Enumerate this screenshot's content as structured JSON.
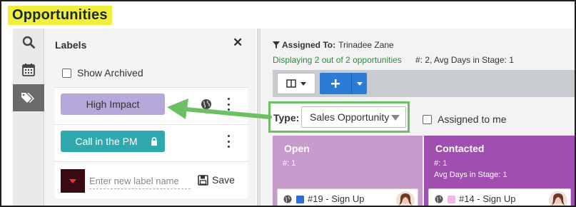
{
  "page_title": "Opportunities",
  "labels_panel": {
    "title": "Labels",
    "show_archived": "Show Archived",
    "labels": [
      {
        "name": "High Impact",
        "color": "#b6a8d9"
      },
      {
        "name": "Call in the PM",
        "color": "#2fa9ae"
      }
    ],
    "new_label_placeholder": "Enter new label name",
    "save": "Save",
    "new_label_color": "#3a0a12"
  },
  "filter": {
    "assigned_to_label": "Assigned To:",
    "assigned_to_value": "Trinadee Zane",
    "displaying": "Displaying 2 out of 2 opportunities",
    "stats": "#: 2, Avg Days in Stage: 1",
    "type_label": "Type:",
    "type_value": "Sales Opportunity",
    "assigned_to_me": "Assigned to me"
  },
  "columns": [
    {
      "title": "Open",
      "count": "#: 1",
      "avg": "",
      "color": "#c79ccc",
      "card": {
        "title": "#19 - Sign Up",
        "square_color": "#2c6fd6"
      }
    },
    {
      "title": "Contacted",
      "count": "#: 1",
      "avg": "Avg Days in Stage: 1",
      "color": "#a04eb0",
      "card": {
        "title": "#14 - Sign Up",
        "square_color": "#f5b5e6"
      }
    }
  ],
  "icons": {
    "rail": [
      "search-icon",
      "calendar-icon",
      "tags-icon"
    ],
    "accent_green": "#6cbf62",
    "highlight_yellow": "#f2ee3c",
    "primary_blue": "#2c7bd4"
  }
}
